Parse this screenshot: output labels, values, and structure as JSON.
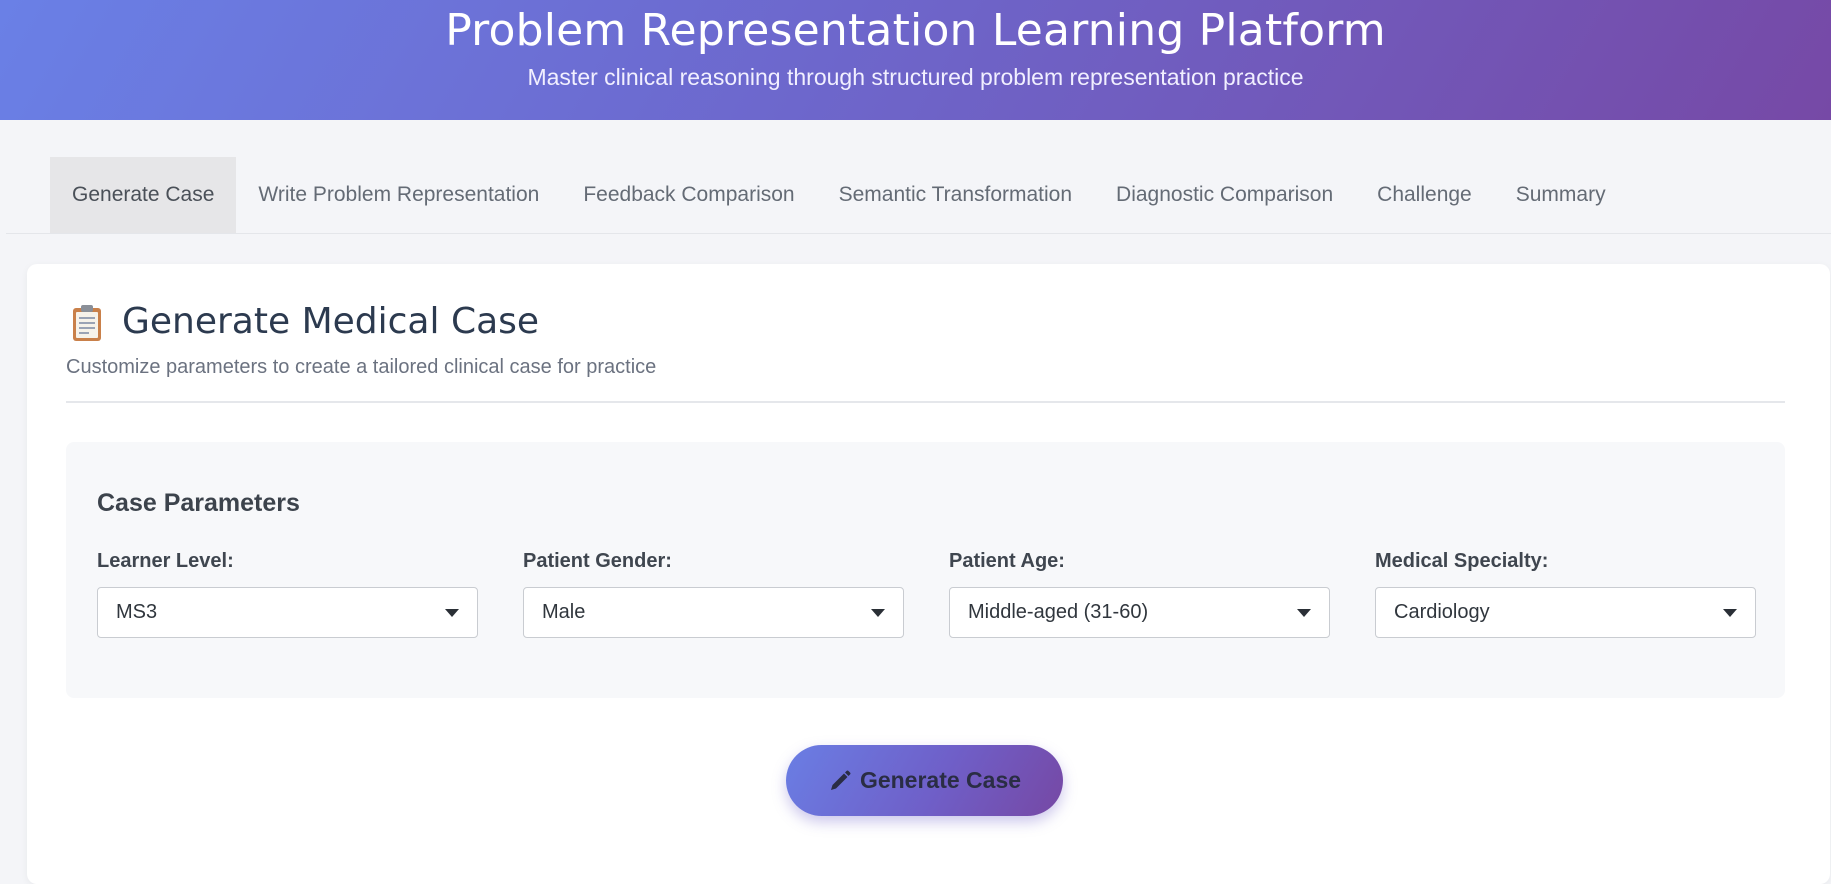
{
  "header": {
    "title": "Problem Representation Learning Platform",
    "subtitle": "Master clinical reasoning through structured problem representation practice"
  },
  "tabs": [
    {
      "label": "Generate Case",
      "active": true
    },
    {
      "label": "Write Problem Representation",
      "active": false
    },
    {
      "label": "Feedback Comparison",
      "active": false
    },
    {
      "label": "Semantic Transformation",
      "active": false
    },
    {
      "label": "Diagnostic Comparison",
      "active": false
    },
    {
      "label": "Challenge",
      "active": false
    },
    {
      "label": "Summary",
      "active": false
    }
  ],
  "card": {
    "icon": "clipboard-icon",
    "title": "Generate Medical Case",
    "subtitle": "Customize parameters to create a tailored clinical case for practice"
  },
  "params": {
    "heading": "Case Parameters",
    "fields": [
      {
        "label": "Learner Level:",
        "value": "MS3"
      },
      {
        "label": "Patient Gender:",
        "value": "Male"
      },
      {
        "label": "Patient Age:",
        "value": "Middle-aged (31-60)"
      },
      {
        "label": "Medical Specialty:",
        "value": "Cardiology"
      }
    ]
  },
  "generate_button": {
    "label": "Generate Case",
    "icon": "pencil-icon"
  },
  "colors": {
    "header_gradient_start": "#6a80e6",
    "header_gradient_end": "#7649a6",
    "active_tab_bg": "#e6e6e8"
  }
}
